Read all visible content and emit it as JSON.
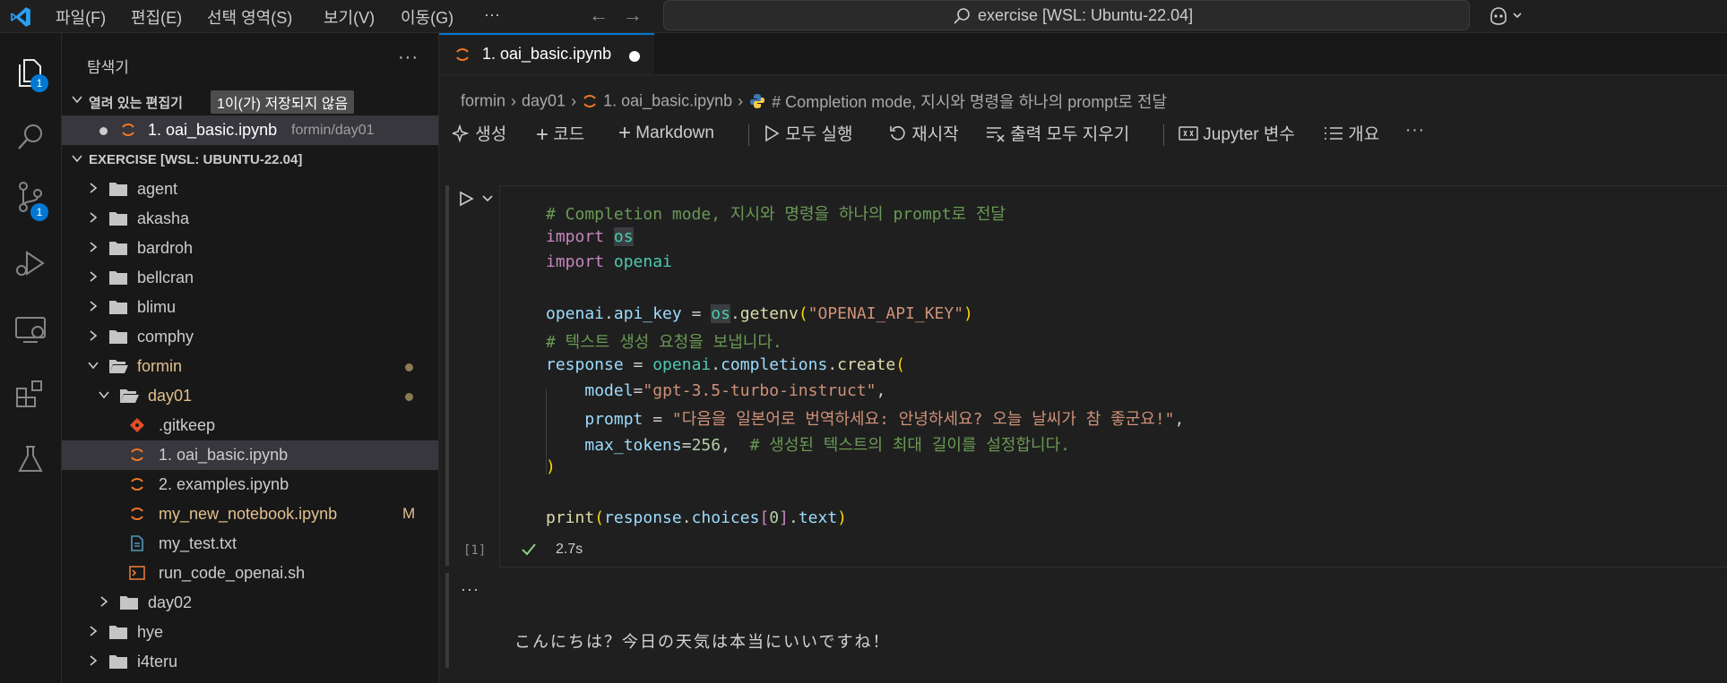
{
  "menu": [
    "파일(F)",
    "편집(E)",
    "선택 영역(S)",
    "보기(V)",
    "이동(G)",
    "···"
  ],
  "command_center": "exercise [WSL: Ubuntu-22.04]",
  "activity": {
    "explorer_badge": "1",
    "scm_badge": "1"
  },
  "sidebar": {
    "title": "탐색기",
    "more": "···",
    "open_editors": {
      "title": "열려 있는 편집기",
      "unsaved": "1이(가) 저장되지 않음",
      "file": "1. oai_basic.ipynb",
      "path": "formin/day01"
    },
    "workspace_title": "EXERCISE [WSL: UBUNTU-22.04]",
    "tree": [
      "agent",
      "akasha",
      "bardroh",
      "bellcran",
      "blimu",
      "comphy",
      "formin",
      "day01",
      ".gitkeep",
      "1. oai_basic.ipynb",
      "2. examples.ipynb",
      "my_new_notebook.ipynb",
      "my_test.txt",
      "run_code_openai.sh",
      "day02",
      "hye",
      "i4teru"
    ],
    "modified_flag": "M"
  },
  "tab": {
    "label": "1. oai_basic.ipynb"
  },
  "breadcrumb": [
    "formin",
    "day01",
    "1. oai_basic.ipynb",
    "# Completion mode, 지시와 명령을 하나의 prompt로 전달"
  ],
  "toolbar": {
    "generate": "생성",
    "code": "코드",
    "markdown": "Markdown",
    "run_all": "모두 실행",
    "restart": "재시작",
    "clear_outputs": "출력 모두 지우기",
    "jupyter_vars": "Jupyter 변수",
    "outline": "개요",
    "more": "···"
  },
  "cell": {
    "exec_count": "[1]",
    "duration": "2.7s",
    "code": [
      "# Completion mode, 지시와 명령을 하나의 prompt로 전달",
      "import os",
      "import openai",
      "",
      "openai.api_key = os.getenv(\"OPENAI_API_KEY\")",
      "# 텍스트 생성 요청을 보냅니다.",
      "response = openai.completions.create(",
      "    model=\"gpt-3.5-turbo-instruct\",",
      "    prompt = \"다음을 일본어로 번역하세요: 안녕하세요? 오늘 날씨가 참 좋군요!\",",
      "    max_tokens=256,  # 생성된 텍스트의 최대 길이를 설정합니다.",
      ")",
      "",
      "print(response.choices[0].text)"
    ]
  },
  "output": {
    "more": "···",
    "text": "こんにちは？今日の天気は本当にいいですね！"
  }
}
